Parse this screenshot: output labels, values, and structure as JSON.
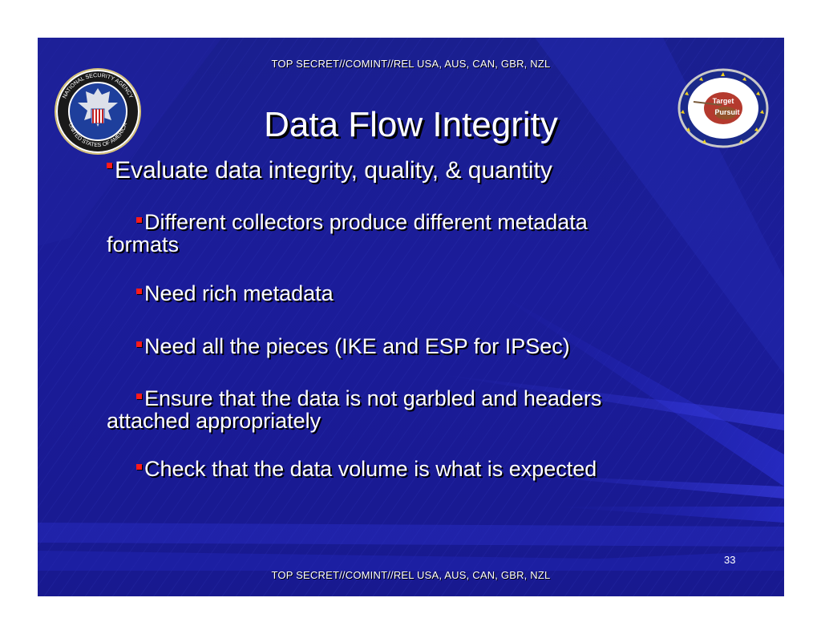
{
  "header": {
    "classification": "TOP SECRET//COMINT//REL USA, AUS, CAN, GBR, NZL"
  },
  "footer": {
    "classification": "TOP SECRET//COMINT//REL USA, AUS, CAN, GBR, NZL",
    "page_number": "33"
  },
  "logos": {
    "seal_text_top": "NATIONAL SECURITY AGENCY",
    "seal_text_bottom": "UNITED STATES OF AMERICA",
    "badge_line1": "Target",
    "badge_line2": "Pursuit"
  },
  "slide": {
    "title": "Data Flow Integrity",
    "main_bullet": "Evaluate data integrity, quality, & quantity",
    "sub_bullets": [
      {
        "line1": "Different collectors produce different metadata",
        "line2": "formats"
      },
      {
        "line1": "Need rich metadata"
      },
      {
        "line1": "Need all the pieces (IKE and ESP for IPSec)"
      },
      {
        "line1": "Ensure that the data is not garbled and headers",
        "line2": "attached appropriately"
      },
      {
        "line1": "Check that the data volume is what is expected"
      }
    ]
  },
  "colors": {
    "background": "#1b1c9a",
    "bullet_marker": "#ff1a1a",
    "text": "#ffffff"
  }
}
